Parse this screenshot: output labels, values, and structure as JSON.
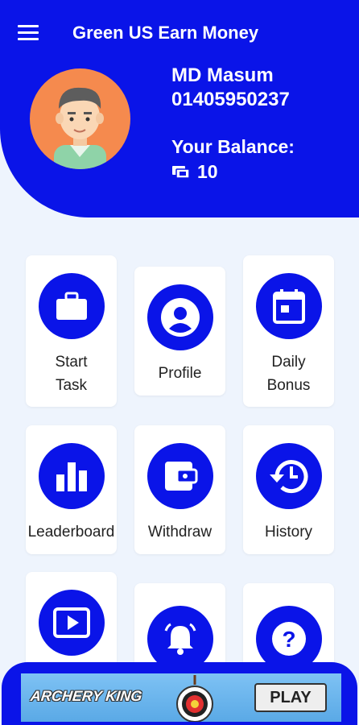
{
  "header": {
    "title": "Green US Earn Money",
    "user_name": "MD Masum",
    "user_phone": "01405950237",
    "balance_label": "Your Balance:",
    "balance_value": "10",
    "balance_icon": "coins-icon",
    "menu_icon": "hamburger-menu-icon"
  },
  "menu_cards": [
    {
      "label": "Start\nTask",
      "icon": "briefcase-icon"
    },
    {
      "label": "Profile",
      "icon": "account-icon"
    },
    {
      "label": "Daily\nBonus",
      "icon": "calendar-icon"
    },
    {
      "label": "Leaderboard",
      "icon": "bar-chart-icon"
    },
    {
      "label": "Withdraw",
      "icon": "wallet-icon"
    },
    {
      "label": "History",
      "icon": "history-icon"
    },
    {
      "label": "",
      "icon": "play-video-icon"
    },
    {
      "label": "",
      "icon": "bell-icon"
    },
    {
      "label": "",
      "icon": "help-icon"
    }
  ],
  "ad": {
    "title": "ARCHERY KING",
    "button": "PLAY"
  },
  "colors": {
    "primary": "#0a14e8",
    "background": "#eef4fd",
    "card": "#ffffff",
    "avatar_bg": "#f58a4e"
  }
}
